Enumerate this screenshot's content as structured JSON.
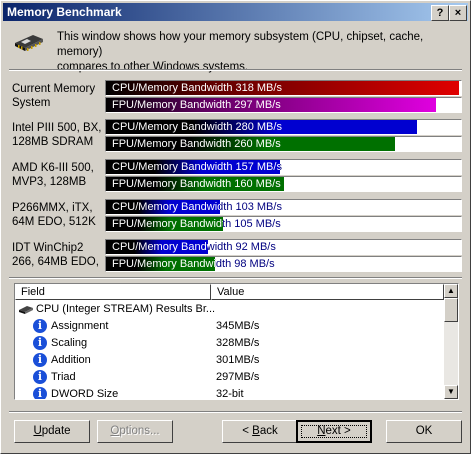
{
  "window": {
    "title": "Memory Benchmark",
    "help_label": "?",
    "close_label": "×"
  },
  "header": {
    "text_line1": "This window shows how your memory subsystem (CPU, chipset, cache, memory)",
    "text_line2": "compares to other Windows systems.",
    "icon": "memory-chip-icon"
  },
  "benchmarks": [
    {
      "label_line1": "Current Memory",
      "label_line2": "System",
      "cpu": {
        "text": "CPU/Memory Bandwidth 318 MB/s",
        "value": 318,
        "color": "#e00000"
      },
      "fpu": {
        "text": "FPU/Memory Bandwidth 297 MB/s",
        "value": 297,
        "color": "#e000e0"
      }
    },
    {
      "label_line1": "Intel PIII 500, BX,",
      "label_line2": "128MB SDRAM",
      "cpu": {
        "text": "CPU/Memory Bandwidth 280 MB/s",
        "value": 280,
        "color": "#0000d0"
      },
      "fpu": {
        "text": "FPU/Memory Bandwidth 260 MB/s",
        "value": 260,
        "color": "#007000"
      }
    },
    {
      "label_line1": "AMD K6-III 500,",
      "label_line2": "MVP3, 128MB",
      "cpu": {
        "text": "CPU/Memory Bandwidth 157 MB/s",
        "value": 157,
        "color": "#0000d0"
      },
      "fpu": {
        "text": "FPU/Memory Bandwidth 160 MB/s",
        "value": 160,
        "color": "#007000"
      }
    },
    {
      "label_line1": "P266MMX, iTX,",
      "label_line2": "64M EDO, 512K",
      "cpu": {
        "text": "CPU/Memory Bandwidth 103 MB/s",
        "value": 103,
        "color": "#0000d0"
      },
      "fpu": {
        "text": "FPU/Memory Bandwidth 105 MB/s",
        "value": 105,
        "color": "#007000"
      }
    },
    {
      "label_line1": "IDT WinChip2",
      "label_line2": "266, 64MB EDO,",
      "cpu": {
        "text": "CPU/Memory Bandwidth 92 MB/s",
        "value": 92,
        "color": "#0000d0"
      },
      "fpu": {
        "text": "FPU/Memory Bandwidth 98 MB/s",
        "value": 98,
        "color": "#007000"
      }
    }
  ],
  "bar_max": 318,
  "results": {
    "columns": [
      "Field",
      "Value"
    ],
    "group": {
      "label": "CPU (Integer STREAM) Results Br...",
      "icon": "cpu-chip-icon"
    },
    "rows": [
      {
        "field": "Assignment",
        "value": "345MB/s",
        "icon": "info-icon"
      },
      {
        "field": "Scaling",
        "value": "328MB/s",
        "icon": "info-icon"
      },
      {
        "field": "Addition",
        "value": "301MB/s",
        "icon": "info-icon"
      },
      {
        "field": "Triad",
        "value": "297MB/s",
        "icon": "info-icon"
      },
      {
        "field": "DWORD Size",
        "value": "32-bit",
        "icon": "info-icon"
      }
    ]
  },
  "buttons": {
    "update": "Update",
    "options": "Options...",
    "back": "< Back",
    "next": "Next >",
    "ok": "OK"
  }
}
